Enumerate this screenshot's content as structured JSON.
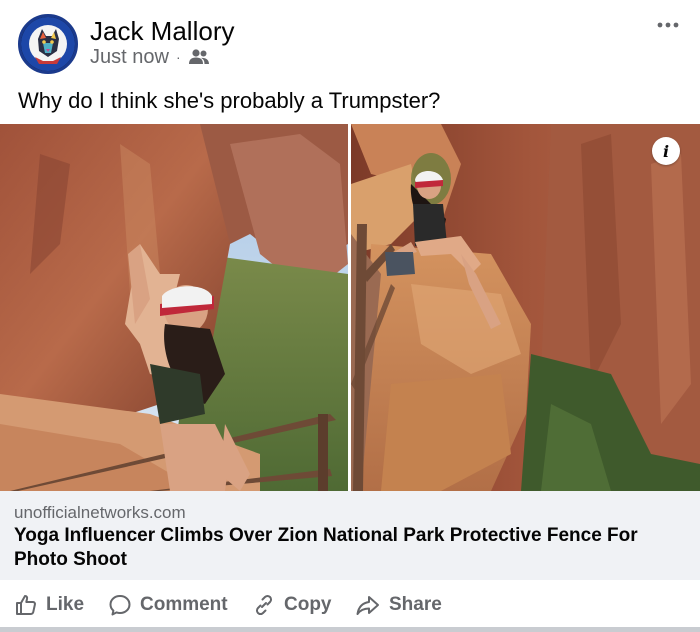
{
  "post": {
    "author_name": "Jack Mallory",
    "timestamp": "Just now",
    "separator": "·",
    "audience_icon": "friends-icon",
    "avatar_text_top": "DOG PEOPLE",
    "avatar_text_bottom": "FOR KAMALA",
    "more_icon": "more-options-icon",
    "text": "Why do I think she's probably a Trumpster?"
  },
  "media": {
    "info_label": "i",
    "info_icon": "info-icon"
  },
  "link_card": {
    "domain": "unofficialnetworks.com",
    "title": "Yoga Influencer Climbs Over Zion National Park Protective Fence For Photo Shoot"
  },
  "actions": {
    "like": "Like",
    "comment": "Comment",
    "copy": "Copy",
    "share": "Share"
  },
  "colors": {
    "secondary_text": "#65676b",
    "card_background": "#f0f2f5"
  }
}
